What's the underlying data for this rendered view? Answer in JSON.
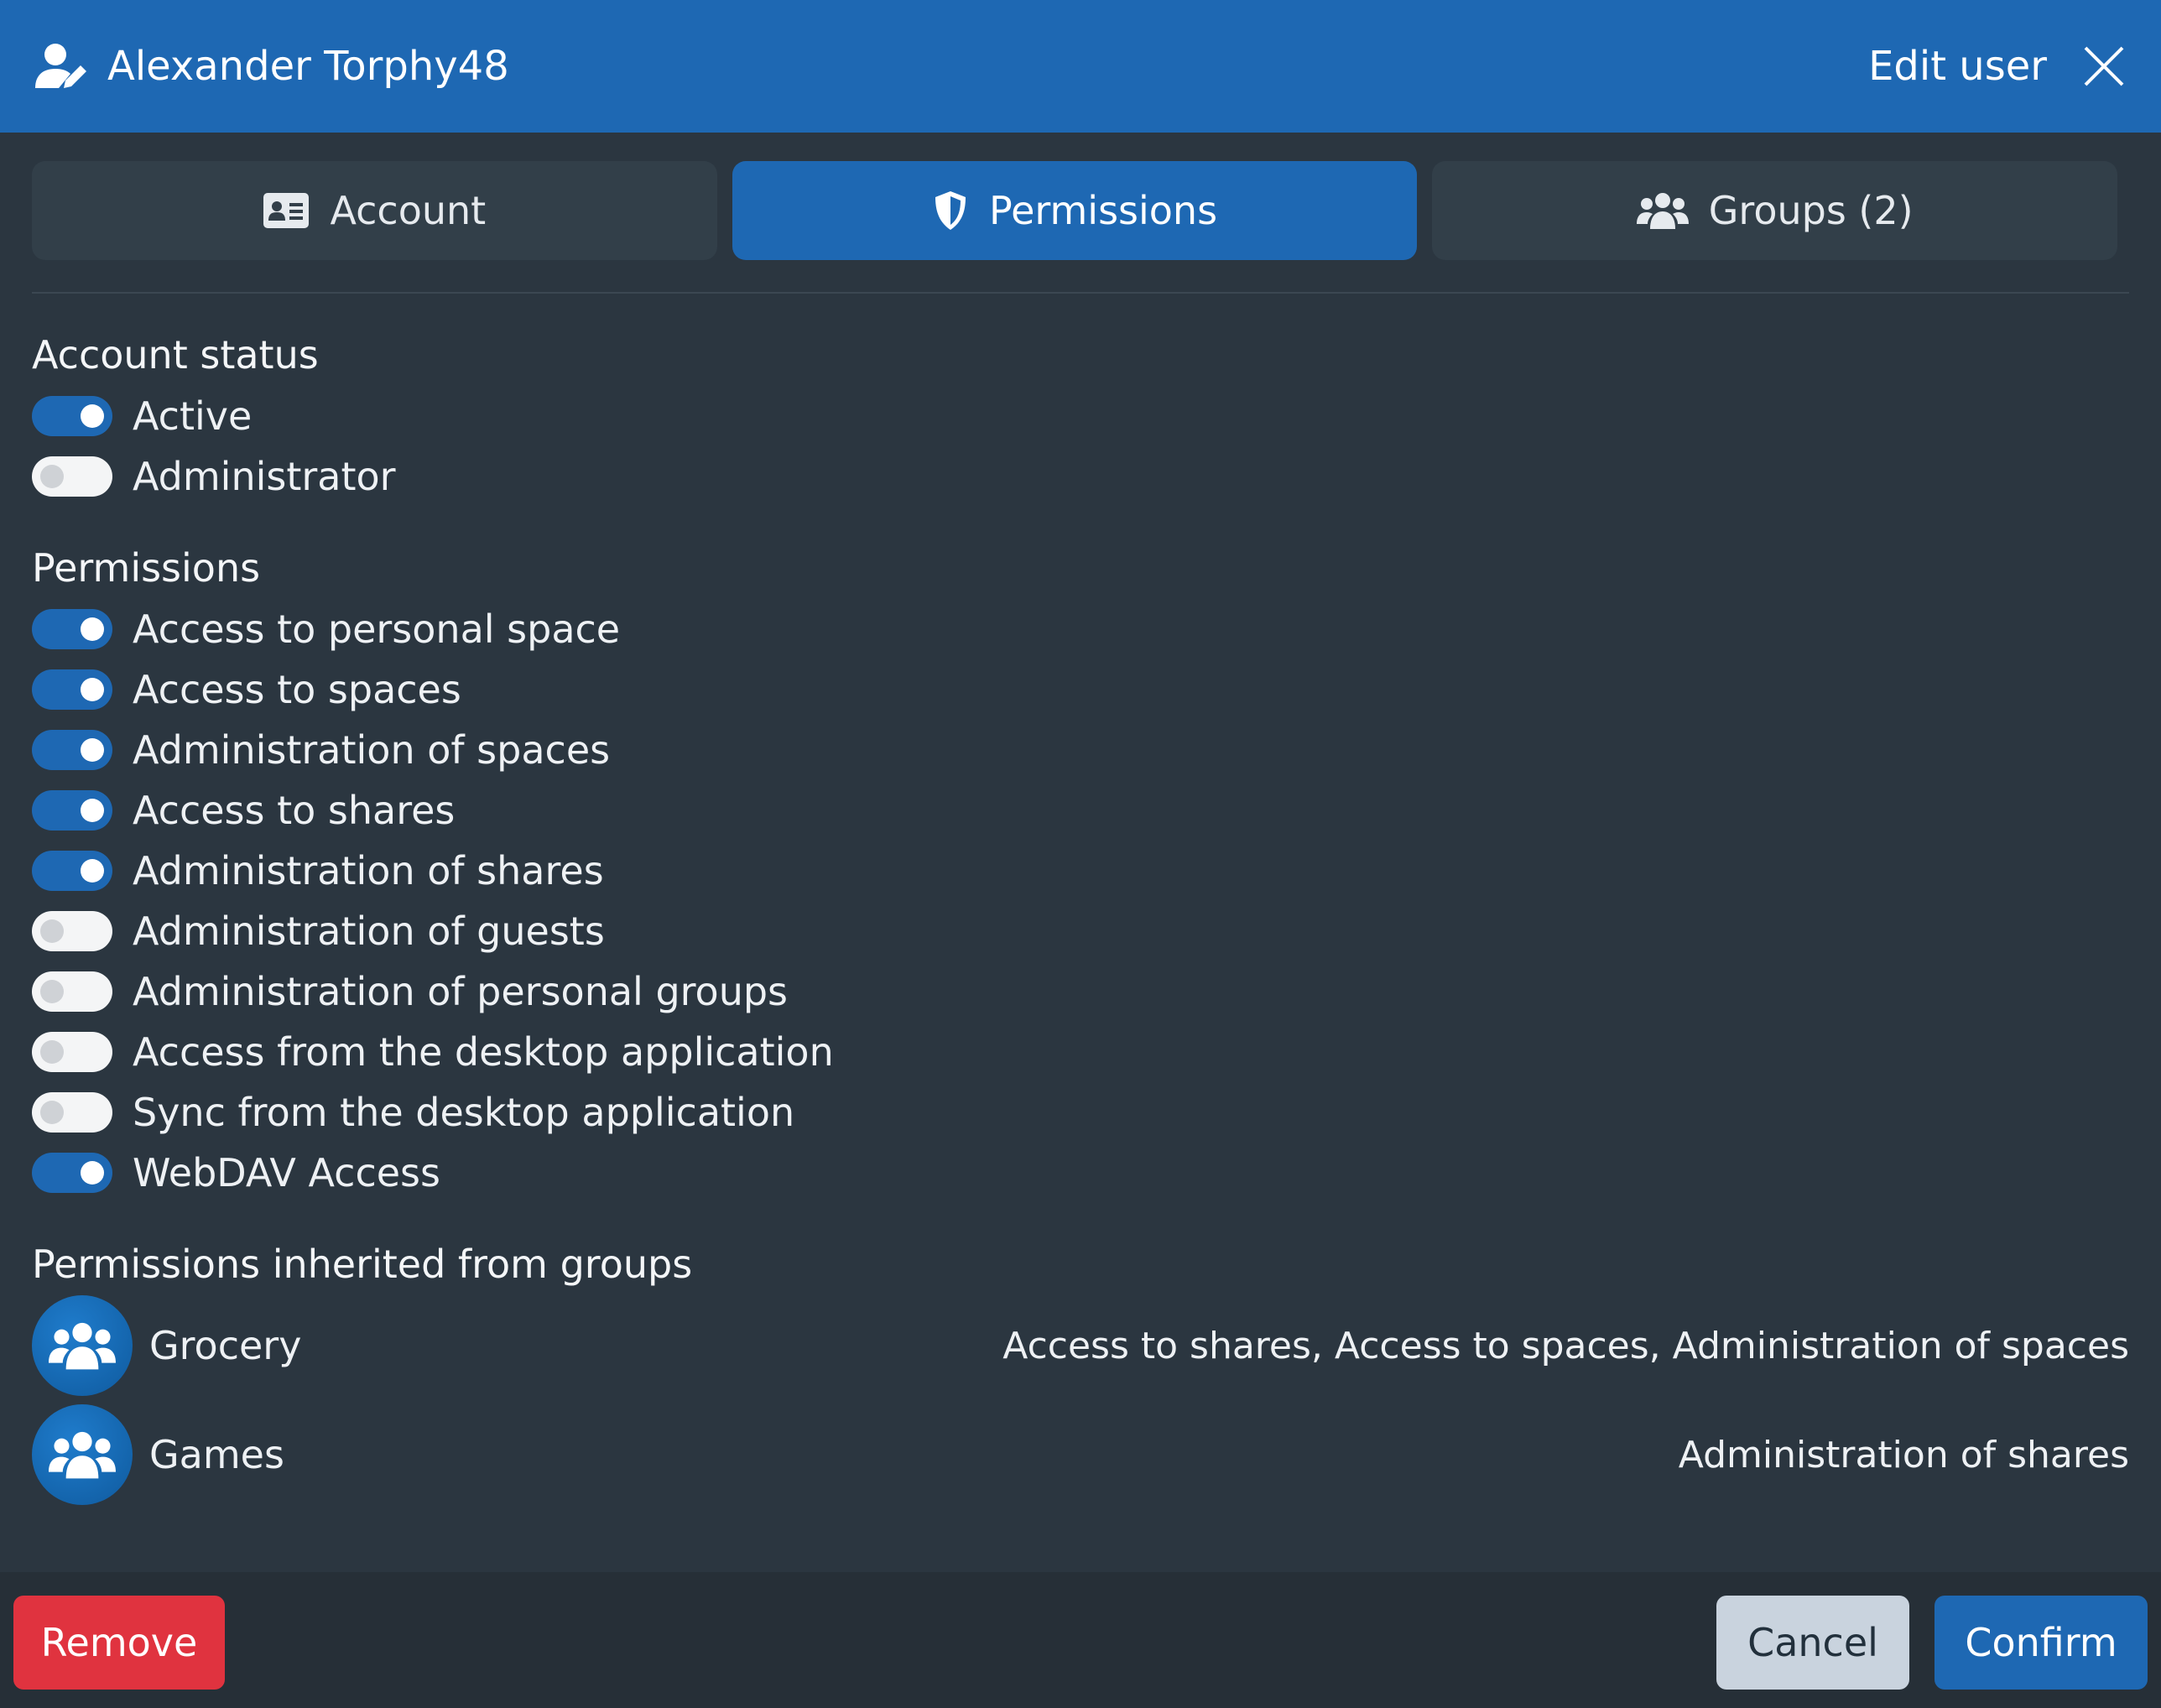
{
  "header": {
    "user_name": "Alexander Torphy48",
    "edit_label": "Edit user"
  },
  "tabs": [
    {
      "label": "Account",
      "icon": "id-card-icon",
      "active": false
    },
    {
      "label": "Permissions",
      "icon": "shield-icon",
      "active": true
    },
    {
      "label": "Groups (2)",
      "icon": "users-icon",
      "active": false
    }
  ],
  "account_status": {
    "title": "Account status",
    "items": [
      {
        "label": "Active",
        "on": true
      },
      {
        "label": "Administrator",
        "on": false
      }
    ]
  },
  "permissions": {
    "title": "Permissions",
    "items": [
      {
        "label": "Access to personal space",
        "on": true
      },
      {
        "label": "Access to spaces",
        "on": true
      },
      {
        "label": "Administration of spaces",
        "on": true
      },
      {
        "label": "Access to shares",
        "on": true
      },
      {
        "label": "Administration of shares",
        "on": true
      },
      {
        "label": "Administration of guests",
        "on": false
      },
      {
        "label": "Administration of personal groups",
        "on": false
      },
      {
        "label": "Access from the desktop application",
        "on": false
      },
      {
        "label": "Sync from the desktop application",
        "on": false
      },
      {
        "label": "WebDAV Access",
        "on": true
      }
    ]
  },
  "inherited": {
    "title": "Permissions inherited from groups",
    "groups": [
      {
        "name": "Grocery",
        "permissions": "Access to shares, Access to spaces, Administration of spaces"
      },
      {
        "name": "Games",
        "permissions": "Administration of shares"
      }
    ]
  },
  "footer": {
    "remove_label": "Remove",
    "cancel_label": "Cancel",
    "confirm_label": "Confirm"
  },
  "colors": {
    "accent": "#1e68b3",
    "background": "#2b3640",
    "danger": "#e0333f",
    "secondary": "#c9d3de"
  }
}
